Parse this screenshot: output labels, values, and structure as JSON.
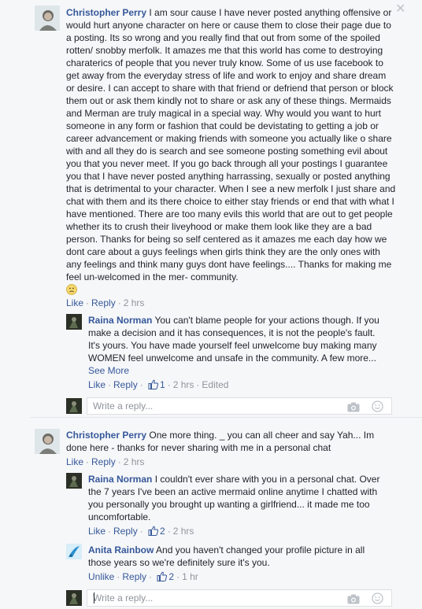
{
  "comment1": {
    "author": "Christopher Perry",
    "text": "I am sour cause I have never posted anything offensive or would hurt anyone character on here or cause them to close their page due to a posting. Its so wrong and you really find that out from some of the spoiled rotten/ snobby merfolk. It amazes me that this world has come to destroying charaterics of people that you never truly know. Some of us use facebook to get away from the everyday stress of life and work to enjoy and share dream or desire. I can accept to share with that friend or defriend that person or block them out or ask them kindly not to share or ask any of these things. Mermaids and Merman are truly magical in a special way. Why would you want to hurt someone in any form or fashion that could be devistating to getting a job or career advancement or making friends with someone you actually like o share with and all they do is search and see someone posting something evil about you that you never meet. If you go back through all your postings I guarantee you that I have never posted anything harrassing, sexually or posted anything that is detrimental to your character. When I see a new merfolk I just share and chat with them and its there choice to either stay friends or end that with what I have mentioned. There are too many evils this world that are out to get people whether its to crush their liveyhood or make them look like they are a bad person. Thanks for being so self centered as it amazes me each day how we dont care about a guys feelings when girls think they are the only ones with any feelings and think many guys dont have feelings.... Thanks for making me feel un-welcomed in the mer- community.",
    "like": "Like",
    "reply": "Reply",
    "time": "2 hrs"
  },
  "reply1": {
    "author": "Raina Norman",
    "text": "You can't blame people for your actions though. If you make a decision and it has consequences, it is not the people's fault. It's yours. You have made yourself feel unwelcome buy making many WOMEN feel unwelcome and unsafe in the community. A few more...",
    "see_more": "See More",
    "like": "Like",
    "reply": "Reply",
    "likes": "1",
    "time": "2 hrs",
    "edited": "Edited"
  },
  "reply_box1": {
    "placeholder": "Write a reply..."
  },
  "comment2": {
    "author": "Christopher Perry",
    "text": "One more thing. _ you can all cheer and say Yah... Im done here - thanks for never sharing with me in a personal chat",
    "like": "Like",
    "reply": "Reply",
    "time": "2 hrs"
  },
  "reply2": {
    "author": "Raina Norman",
    "text": "I couldn't ever share with you in a personal chat. Over the 7 years I've been an active mermaid online anytime I chatted with you personally you brought up wanting a girlfriend... it made me too uncomfortable.",
    "like": "Like",
    "reply": "Reply",
    "likes": "2",
    "time": "2 hrs"
  },
  "reply3": {
    "author": "Anita Rainbow",
    "text": "And you haven't changed your profile picture in all those years so we're definitely sure it's you.",
    "unlike": "Unlike",
    "reply": "Reply",
    "likes": "2",
    "time": "1 hr"
  },
  "reply_box2": {
    "placeholder": "Write a reply..."
  },
  "colors": {
    "link": "#365899",
    "meta": "#90949c",
    "text": "#1d2129",
    "bg": "#f6f7f9"
  }
}
